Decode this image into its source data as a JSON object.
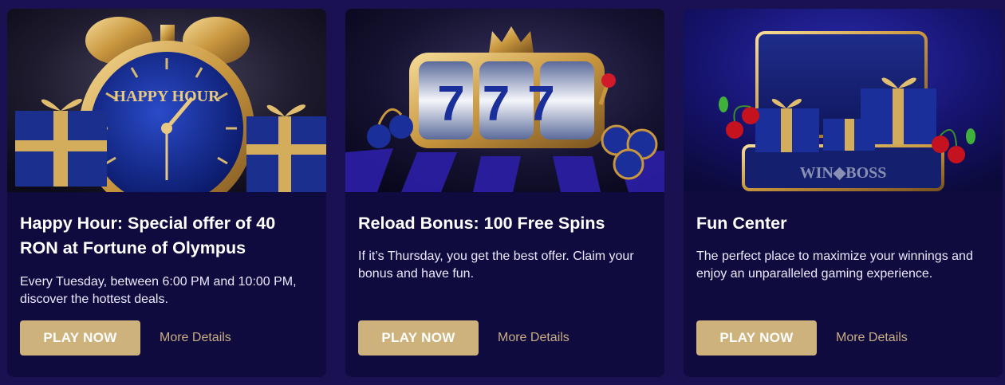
{
  "promotions": [
    {
      "image_name": "happy-hour-clock-image",
      "image_text": "HAPPY HOUR",
      "title": "Happy Hour: Special offer of 40 RON at Fortune of Olympus",
      "description": "Every Tuesday, between 6:00 PM and 10:00 PM, discover the hottest deals.",
      "button_label": "PLAY NOW",
      "link_label": "More Details"
    },
    {
      "image_name": "slot-reels-777-image",
      "image_text": "777",
      "title": "Reload Bonus: 100 Free Spins",
      "description": "If it’s Thursday, you get the best offer. Claim your bonus and have fun.",
      "button_label": "PLAY NOW",
      "link_label": "More Details"
    },
    {
      "image_name": "gift-chest-image",
      "image_text": "WIN◆BOSS",
      "title": "Fun Center",
      "description": "The perfect place to maximize your winnings and enjoy an unparalleled gaming experience.",
      "button_label": "PLAY NOW",
      "link_label": "More Details"
    }
  ],
  "colors": {
    "page_background": "#1a1152",
    "card_background": "#0f0b3e",
    "button_background": "#cdb27c",
    "link_color": "#c9ad82",
    "accent_gold": "#d4ad5c",
    "accent_blue": "#1f3aa8"
  }
}
